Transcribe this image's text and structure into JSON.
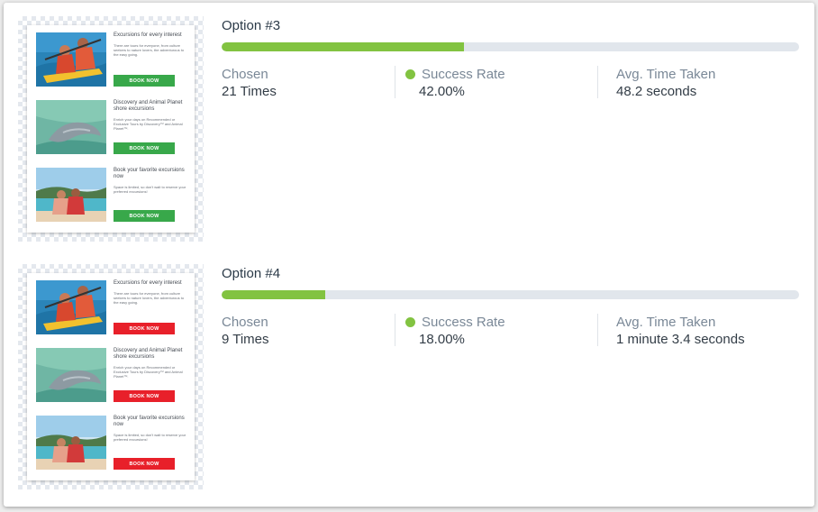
{
  "colors": {
    "progress_fill": "#82c341",
    "progress_track": "#e1e6ec",
    "book_green": "#38a84a",
    "book_red": "#e8202a"
  },
  "options": [
    {
      "title": "Option #3",
      "progress_fraction": 0.42,
      "chosen_label": "Chosen",
      "chosen_value": "21 Times",
      "success_label": "Success Rate",
      "success_value": "42.00%",
      "time_label": "Avg. Time Taken",
      "time_value": "48.2 seconds",
      "button_color": "#38a84a",
      "email": [
        {
          "title": "Excursions for every interest",
          "desc": "There are tours for everyone, from culture seekers to nature lovers, the adventurous to the easy going.",
          "button": "BOOK NOW"
        },
        {
          "title": "Discovery and Animal Planet shore excursions",
          "desc": "Enrich your days on Recommended or Exclusive Tours by Discovery™ and Animal Planet™.",
          "button": "BOOK NOW"
        },
        {
          "title": "Book your favorite excursions now",
          "desc": "Space is limited, so don't wait to reserve your preferred excursions!",
          "button": "BOOK NOW"
        }
      ]
    },
    {
      "title": "Option #4",
      "progress_fraction": 0.18,
      "chosen_label": "Chosen",
      "chosen_value": "9 Times",
      "success_label": "Success Rate",
      "success_value": "18.00%",
      "time_label": "Avg. Time Taken",
      "time_value": "1 minute 3.4 seconds",
      "button_color": "#e8202a",
      "email": [
        {
          "title": "Excursions for every interest",
          "desc": "There are tours for everyone, from culture seekers to nature lovers, the adventurous to the easy going.",
          "button": "BOOK NOW"
        },
        {
          "title": "Discovery and Animal Planet shore excursions",
          "desc": "Enrich your days on Recommended or Exclusive Tours by Discovery™ and Animal Planet™.",
          "button": "BOOK NOW"
        },
        {
          "title": "Book your favorite excursions now",
          "desc": "Space is limited, so don't wait to reserve your preferred excursions!",
          "button": "BOOK NOW"
        }
      ]
    }
  ]
}
